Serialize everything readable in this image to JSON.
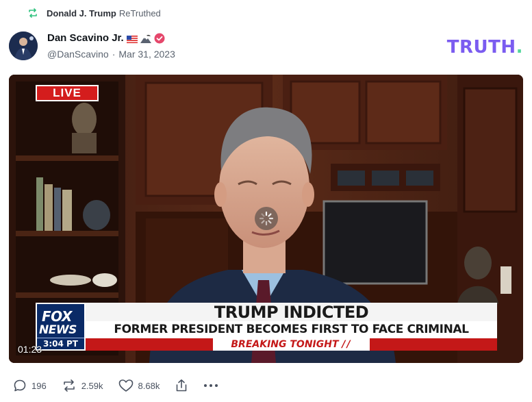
{
  "retruth": {
    "author": "Donald J. Trump",
    "suffix": "ReTruthed",
    "icon": "retruth-icon",
    "color": "#2ec27e"
  },
  "post": {
    "author_name": "Dan Scavino Jr.",
    "flag_icons": [
      "us-flag-icon",
      "eagle-mountain-icon"
    ],
    "verified_icon": "verified-icon",
    "handle": "@DanScavino",
    "separator": "·",
    "date": "Mar 31, 2023"
  },
  "brand": {
    "logo_text": "TRUTH",
    "logo_dot": ".",
    "color": "#7b5cf0",
    "dot_color": "#53d69c"
  },
  "video": {
    "live_badge": "LIVE",
    "network_line1": "FOX",
    "network_line2": "NEWS",
    "network_time": "3:04 PT",
    "headline": "TRUMP INDICTED",
    "subheadline": "FORMER PRESIDENT BECOMES FIRST TO FACE CRIMINAL CHARGES",
    "breaking_label": "BREAKING TONIGHT",
    "breaking_stripes": "//",
    "timecode": "01:23",
    "loading_icon": "spinner-icon"
  },
  "actions": {
    "replies": "196",
    "retruths": "2.59k",
    "likes": "8.68k",
    "share_icon": "share-icon",
    "more_icon": "more-icon"
  }
}
